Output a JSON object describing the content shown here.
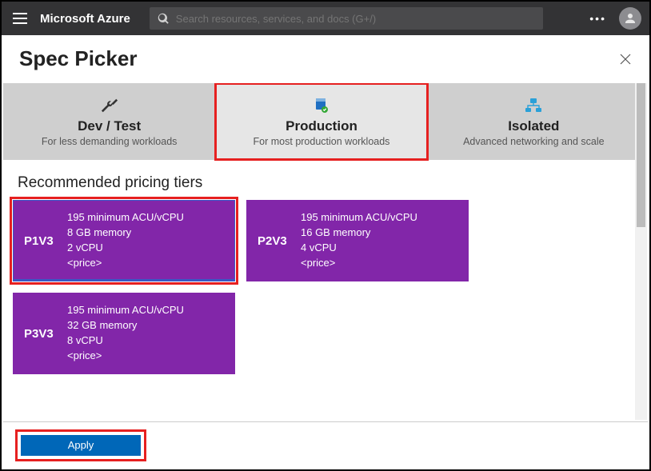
{
  "header": {
    "brand": "Microsoft Azure",
    "search_placeholder": "Search resources, services, and docs (G+/)"
  },
  "page": {
    "title": "Spec Picker"
  },
  "categories": [
    {
      "key": "devtest",
      "title": "Dev / Test",
      "subtitle": "For less demanding workloads",
      "active": false,
      "highlight": false
    },
    {
      "key": "production",
      "title": "Production",
      "subtitle": "For most production workloads",
      "active": true,
      "highlight": true
    },
    {
      "key": "isolated",
      "title": "Isolated",
      "subtitle": "Advanced networking and scale",
      "active": false,
      "highlight": false
    }
  ],
  "section": {
    "recommended_heading": "Recommended pricing tiers"
  },
  "tiers": [
    {
      "sku": "P1V3",
      "acu": "195 minimum ACU/vCPU",
      "memory": "8 GB memory",
      "vcpu": "2 vCPU",
      "price": "<price>",
      "selected": true
    },
    {
      "sku": "P2V3",
      "acu": "195 minimum ACU/vCPU",
      "memory": "16 GB memory",
      "vcpu": "4 vCPU",
      "price": "<price>",
      "selected": false
    },
    {
      "sku": "P3V3",
      "acu": "195 minimum ACU/vCPU",
      "memory": "32 GB memory",
      "vcpu": "8 vCPU",
      "price": "<price>",
      "selected": false
    }
  ],
  "actions": {
    "apply_label": "Apply"
  },
  "colors": {
    "tier_bg": "#8226a9",
    "apply_bg": "#0067b8",
    "highlight": "#e62020"
  }
}
